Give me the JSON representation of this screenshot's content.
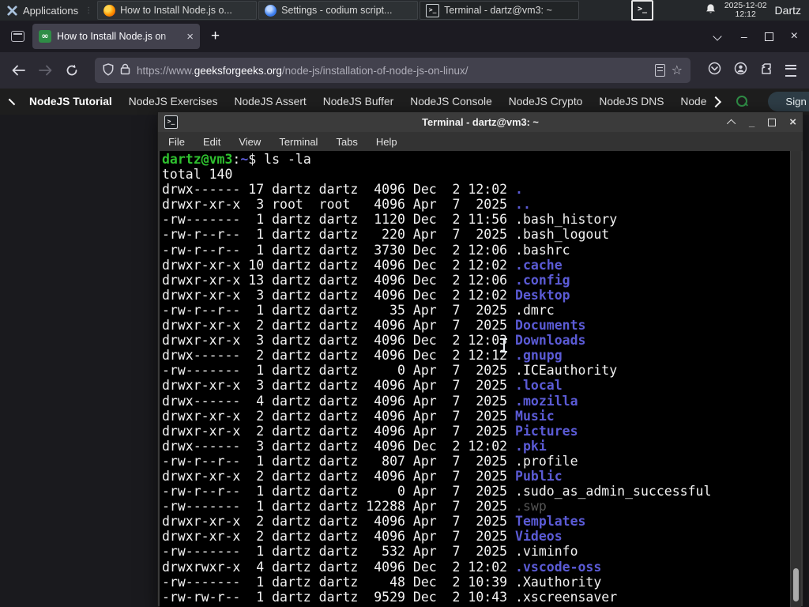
{
  "panel": {
    "applications_label": "Applications",
    "windows": [
      {
        "label": "How to Install Node.js o...",
        "icon": "firefox"
      },
      {
        "label": "Settings - codium script...",
        "icon": "codium"
      },
      {
        "label": "Terminal - dartz@vm3: ~",
        "icon": "terminal",
        "active": true
      }
    ],
    "tray_terminal_glyph": ">_",
    "clock_date": "2025-12-02",
    "clock_time": "12:12",
    "user": "Dartz"
  },
  "browser": {
    "tab": {
      "title": "How to Install Node.js on",
      "favicon_glyph": "∞",
      "close_glyph": "×"
    },
    "new_tab_glyph": "+",
    "url": {
      "scheme": "https://www.",
      "domain": "geeksforgeeks.org",
      "path": "/node-js/installation-of-node-js-on-linux/"
    },
    "nav_links": [
      "NodeJS Tutorial",
      "NodeJS Exercises",
      "NodeJS Assert",
      "NodeJS Buffer",
      "NodeJS Console",
      "NodeJS Crypto",
      "NodeJS DNS",
      "Node"
    ],
    "sign_in_label": "Sign In"
  },
  "terminal": {
    "title": "Terminal - dartz@vm3: ~",
    "menu": [
      "File",
      "Edit",
      "View",
      "Terminal",
      "Tabs",
      "Help"
    ],
    "prompt": {
      "user_host": "dartz@vm3",
      "colon": ":",
      "cwd": "~",
      "dollar": "$ ",
      "command": "ls -la"
    },
    "total_line": "total 140",
    "listing": [
      {
        "pre": "drwx------ 17 dartz dartz  4096 Dec  2 12:02 ",
        "name": ".",
        "type": "dir"
      },
      {
        "pre": "drwxr-xr-x  3 root  root   4096 Apr  7  2025 ",
        "name": "..",
        "type": "dir"
      },
      {
        "pre": "-rw-------  1 dartz dartz  1120 Dec  2 11:56 ",
        "name": ".bash_history",
        "type": "file"
      },
      {
        "pre": "-rw-r--r--  1 dartz dartz   220 Apr  7  2025 ",
        "name": ".bash_logout",
        "type": "file"
      },
      {
        "pre": "-rw-r--r--  1 dartz dartz  3730 Dec  2 12:06 ",
        "name": ".bashrc",
        "type": "file"
      },
      {
        "pre": "drwxr-xr-x 10 dartz dartz  4096 Dec  2 12:02 ",
        "name": ".cache",
        "type": "dir"
      },
      {
        "pre": "drwxr-xr-x 13 dartz dartz  4096 Dec  2 12:06 ",
        "name": ".config",
        "type": "dir"
      },
      {
        "pre": "drwxr-xr-x  3 dartz dartz  4096 Dec  2 12:02 ",
        "name": "Desktop",
        "type": "dir"
      },
      {
        "pre": "-rw-r--r--  1 dartz dartz    35 Apr  7  2025 ",
        "name": ".dmrc",
        "type": "file"
      },
      {
        "pre": "drwxr-xr-x  2 dartz dartz  4096 Apr  7  2025 ",
        "name": "Documents",
        "type": "dir"
      },
      {
        "pre": "drwxr-xr-x  3 dartz dartz  4096 Dec  2 12:03 ",
        "name": "Downloads",
        "type": "dir"
      },
      {
        "pre": "drwx------  2 dartz dartz  4096 Dec  2 12:12 ",
        "name": ".gnupg",
        "type": "dir"
      },
      {
        "pre": "-rw-------  1 dartz dartz     0 Apr  7  2025 ",
        "name": ".ICEauthority",
        "type": "file"
      },
      {
        "pre": "drwxr-xr-x  3 dartz dartz  4096 Apr  7  2025 ",
        "name": ".local",
        "type": "dir"
      },
      {
        "pre": "drwx------  4 dartz dartz  4096 Apr  7  2025 ",
        "name": ".mozilla",
        "type": "dir"
      },
      {
        "pre": "drwxr-xr-x  2 dartz dartz  4096 Apr  7  2025 ",
        "name": "Music",
        "type": "dir"
      },
      {
        "pre": "drwxr-xr-x  2 dartz dartz  4096 Apr  7  2025 ",
        "name": "Pictures",
        "type": "dir"
      },
      {
        "pre": "drwx------  3 dartz dartz  4096 Dec  2 12:02 ",
        "name": ".pki",
        "type": "dir"
      },
      {
        "pre": "-rw-r--r--  1 dartz dartz   807 Apr  7  2025 ",
        "name": ".profile",
        "type": "file"
      },
      {
        "pre": "drwxr-xr-x  2 dartz dartz  4096 Apr  7  2025 ",
        "name": "Public",
        "type": "dir"
      },
      {
        "pre": "-rw-r--r--  1 dartz dartz     0 Apr  7  2025 ",
        "name": ".sudo_as_admin_successful",
        "type": "file"
      },
      {
        "pre": "-rw-------  1 dartz dartz 12288 Apr  7  2025 ",
        "name": ".swp",
        "type": "dim"
      },
      {
        "pre": "drwxr-xr-x  2 dartz dartz  4096 Apr  7  2025 ",
        "name": "Templates",
        "type": "dir"
      },
      {
        "pre": "drwxr-xr-x  2 dartz dartz  4096 Apr  7  2025 ",
        "name": "Videos",
        "type": "dir"
      },
      {
        "pre": "-rw-------  1 dartz dartz   532 Apr  7  2025 ",
        "name": ".viminfo",
        "type": "file"
      },
      {
        "pre": "drwxrwxr-x  4 dartz dartz  4096 Dec  2 12:02 ",
        "name": ".vscode-oss",
        "type": "dir"
      },
      {
        "pre": "-rw-------  1 dartz dartz    48 Dec  2 10:39 ",
        "name": ".Xauthority",
        "type": "file"
      },
      {
        "pre": "-rw-rw-r--  1 dartz dartz  9529 Dec  2 10:43 ",
        "name": ".xscreensaver",
        "type": "file"
      }
    ]
  },
  "colors": {
    "gfg_green": "#2f8d46",
    "terminal_dir_blue": "#5b5bd6",
    "terminal_prompt_green": "#2fc12f",
    "terminal_bg": "#000000",
    "panel_bg": "#25282b",
    "firefox_toolbar": "#2b2a33"
  }
}
